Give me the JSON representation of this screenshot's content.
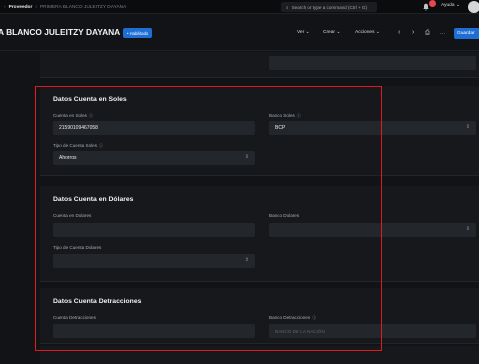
{
  "topnav": {
    "breadcrumb_parent": "Proveedor",
    "breadcrumb_current": "PRIMERA BLANCO JULEITZY DAYANA",
    "search_placeholder": "Search or type a command (Ctrl + G)",
    "help_label": "Ayuda"
  },
  "header": {
    "title": "A BLANCO JULEITZY DAYANA",
    "status": "• Habilitado",
    "ver": "Ver",
    "crear": "Crear",
    "acciones": "Acciones",
    "prev": "‹",
    "next": "›",
    "print": "⎙",
    "more": "···",
    "save": "Guardar"
  },
  "soles": {
    "title": "Datos Cuenta en Soles",
    "cuenta_label": "Cuenta en Soles",
    "cuenta_value": "21590109467058",
    "banco_label": "Banco Soles",
    "banco_value": "BCP",
    "tipo_label": "Tipo de Cuenta Soles",
    "tipo_value": "Ahorros"
  },
  "dolares": {
    "title": "Datos Cuenta en Dólares",
    "cuenta_label": "Cuenta en Dolares",
    "banco_label": "Banco Dolares",
    "tipo_label": "Tipo de Cuenta Dolares"
  },
  "detracciones": {
    "title": "Datos Cuenta Detracciones",
    "cuenta_label": "Cuenta Detracciones",
    "banco_label": "Banco Detracciones",
    "banco_placeholder": "BANCO DE LA NACIÓN"
  },
  "icons": {
    "info": "ⓘ",
    "chevron_updown": "⌃⌄",
    "search": "⌕",
    "bell": "🔔"
  }
}
